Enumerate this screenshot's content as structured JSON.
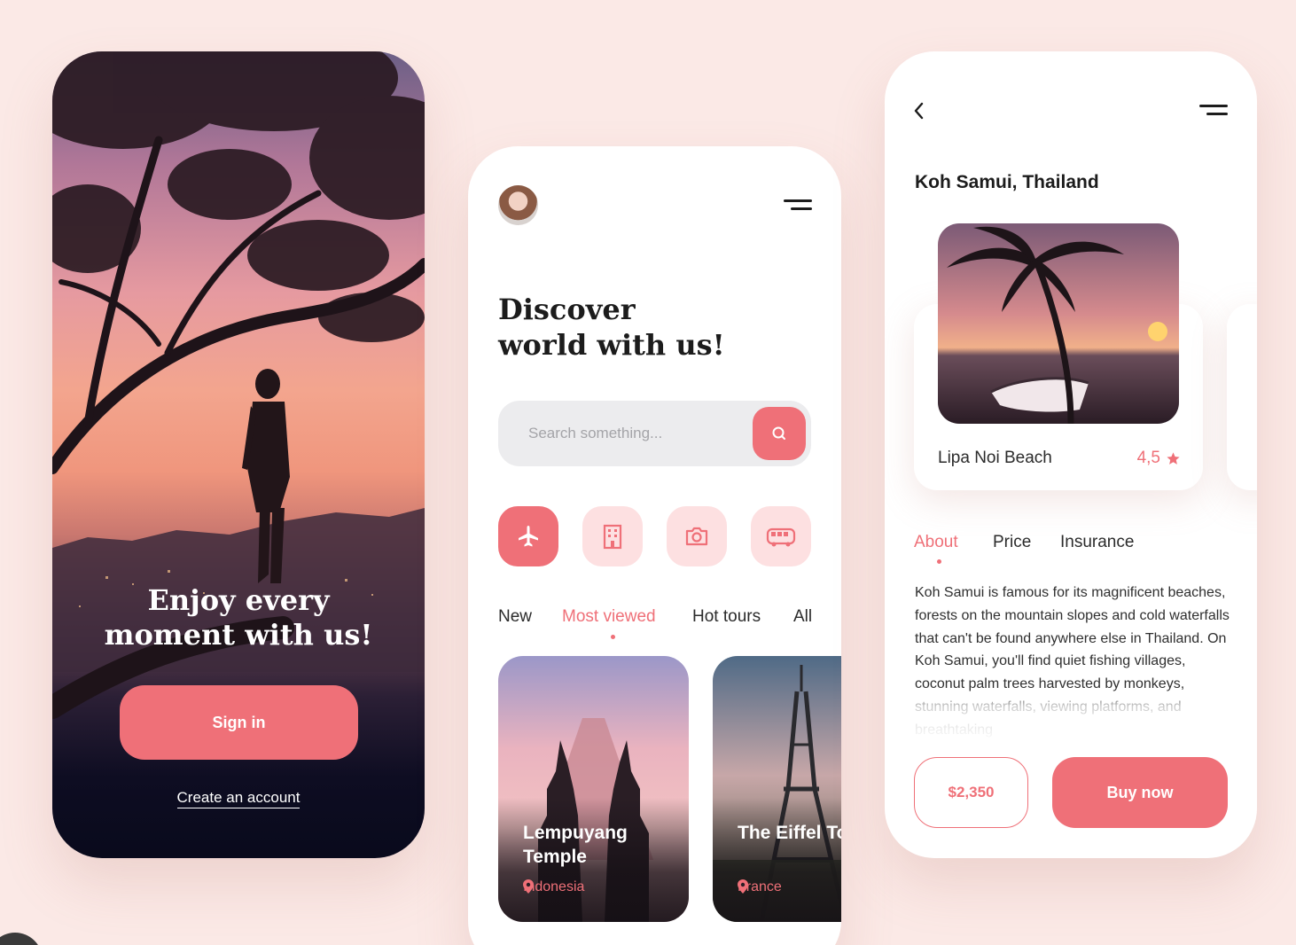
{
  "colors": {
    "accent": "#ef7078",
    "accent_light": "#fde0e1",
    "background": "#fbe9e6"
  },
  "welcome_screen": {
    "headline_line1": "Enjoy every",
    "headline_line2": "moment with us!",
    "signin_label": "Sign in",
    "create_account_label": "Create an account"
  },
  "discover_screen": {
    "title_line1": "Discover",
    "title_line2": "world with us!",
    "search": {
      "placeholder": "Search something..."
    },
    "categories": [
      {
        "icon": "airplane-icon",
        "active": true
      },
      {
        "icon": "hotel-icon",
        "active": false
      },
      {
        "icon": "camera-icon",
        "active": false
      },
      {
        "icon": "bus-icon",
        "active": false
      }
    ],
    "tabs": [
      {
        "label": "New",
        "active": false
      },
      {
        "label": "Most viewed",
        "active": true
      },
      {
        "label": "Hot tours",
        "active": false
      },
      {
        "label": "All",
        "active": false
      }
    ],
    "cards": [
      {
        "title": "Lempuyang Temple",
        "location": "Indonesia"
      },
      {
        "title": "The Eiffel Tower",
        "location": "France"
      }
    ]
  },
  "detail_screen": {
    "title": "Koh Samui, Thailand",
    "place": {
      "name": "Lipa Noi Beach",
      "rating": "4,5"
    },
    "tabs": [
      {
        "label": "About",
        "active": true
      },
      {
        "label": "Price",
        "active": false
      },
      {
        "label": "Insurance",
        "active": false
      }
    ],
    "description": "Koh Samui is famous for its magnificent beaches, forests on the mountain slopes and cold waterfalls that can't be found anywhere else in Thailand. On Koh Samui, you'll find quiet fishing villages, coconut palm trees harvested by monkeys, stunning waterfalls, viewing platforms, and breathtaking",
    "price": "$2,350",
    "buy_label": "Buy now"
  }
}
